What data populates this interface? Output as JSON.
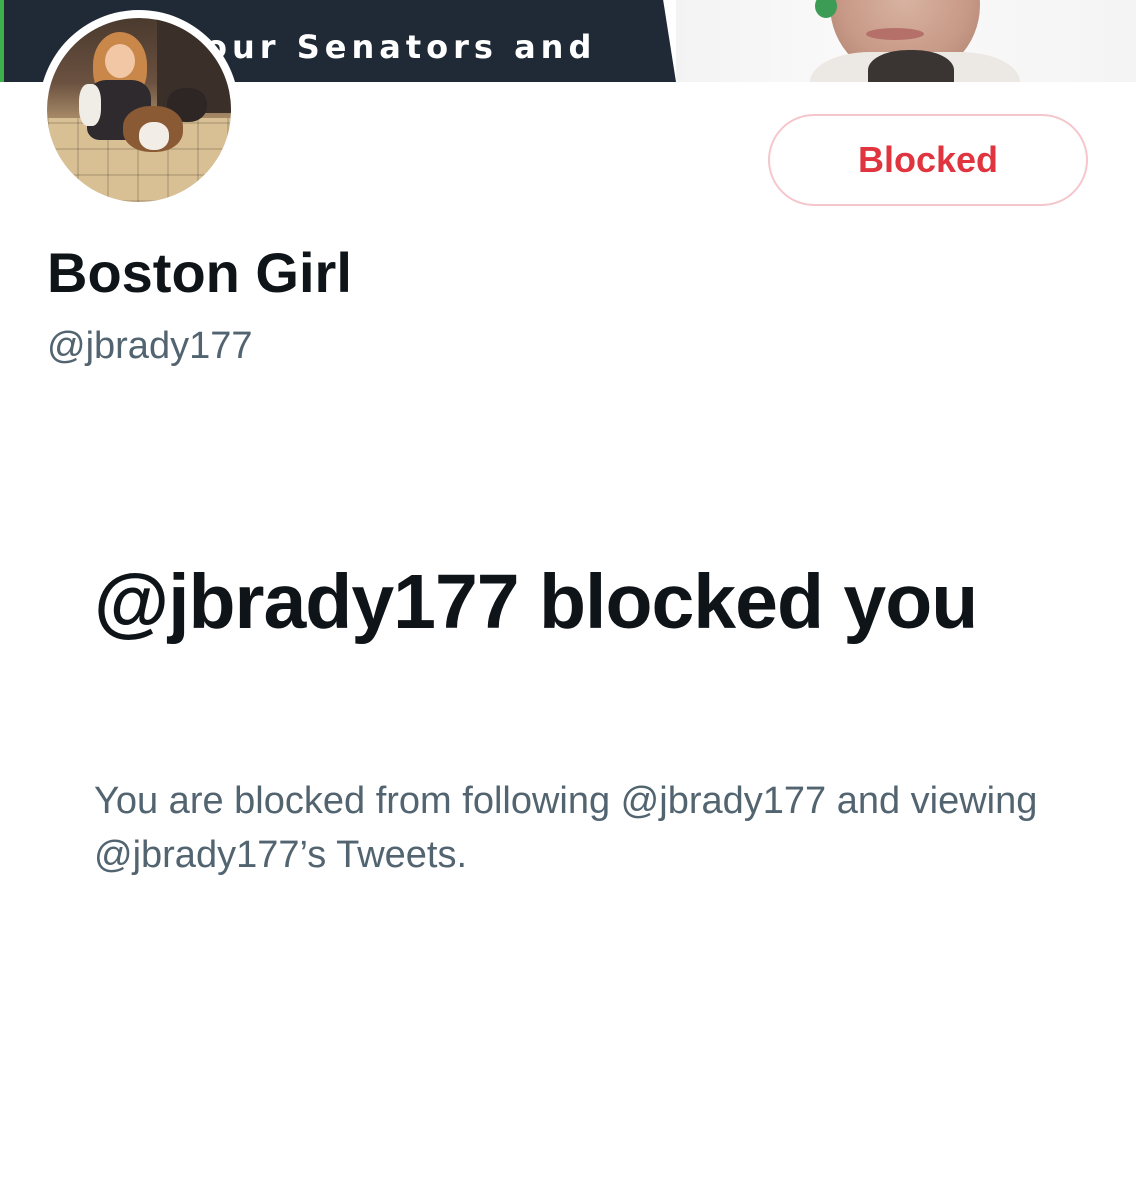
{
  "banner": {
    "text": "our Senators and"
  },
  "profile": {
    "display_name": "Boston Girl",
    "handle": "@jbrady177",
    "blocked_button_label": "Blocked"
  },
  "blocked_notice": {
    "title": "@jbrady177 blocked you",
    "description": "You are blocked from following @jbrady177 and viewing @jbrady177’s Tweets."
  },
  "colors": {
    "blocked_red": "#e0353f",
    "blocked_border": "#f5c6cc",
    "primary_text": "#0f1419",
    "secondary_text": "#536471",
    "banner_dark": "#1f2a36"
  }
}
